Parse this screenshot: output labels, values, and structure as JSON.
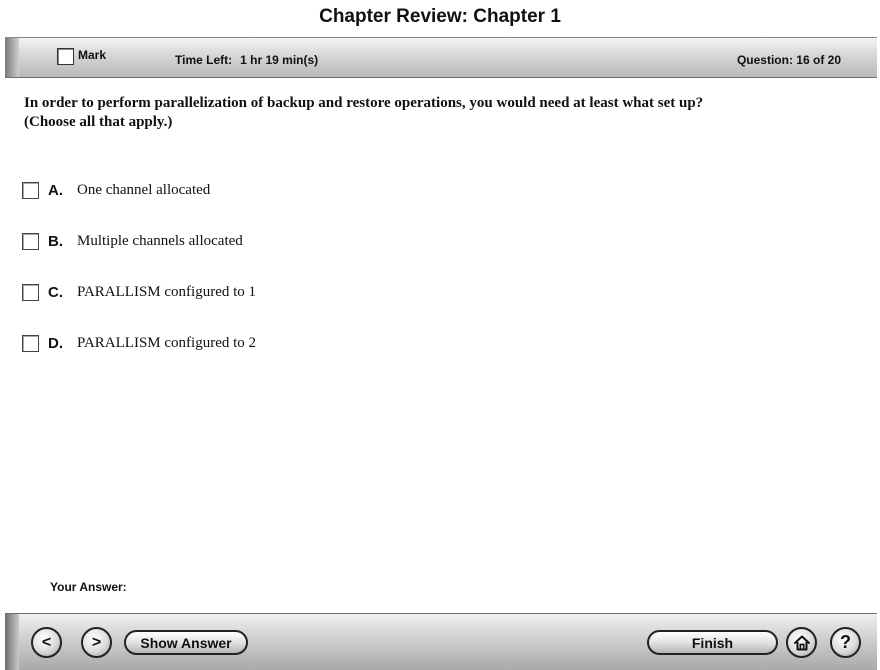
{
  "header": {
    "title": "Chapter Review: Chapter 1"
  },
  "topbar": {
    "mark_label": "Mark",
    "time_left_label": "Time Left:",
    "time_left_value": "1 hr 19 min(s)",
    "question_counter": "Question: 16 of 20"
  },
  "question": {
    "line1": "In order to perform parallelization of backup and restore operations, you would need at least what set up?",
    "line2": "(Choose all that apply.)"
  },
  "options": [
    {
      "letter": "A.",
      "text": "One channel allocated"
    },
    {
      "letter": "B.",
      "text": "Multiple channels allocated"
    },
    {
      "letter": "C.",
      "text": "PARALLISM configured to 1"
    },
    {
      "letter": "D.",
      "text": "PARALLISM configured to 2"
    }
  ],
  "your_answer_label": "Your Answer:",
  "bottombar": {
    "prev_label": "<",
    "next_label": ">",
    "show_answer_label": "Show Answer",
    "finish_label": "Finish",
    "help_label": "?"
  },
  "icons": {
    "prev": "chevron-left-icon",
    "next": "chevron-right-icon",
    "home": "home-icon",
    "help": "help-icon"
  }
}
